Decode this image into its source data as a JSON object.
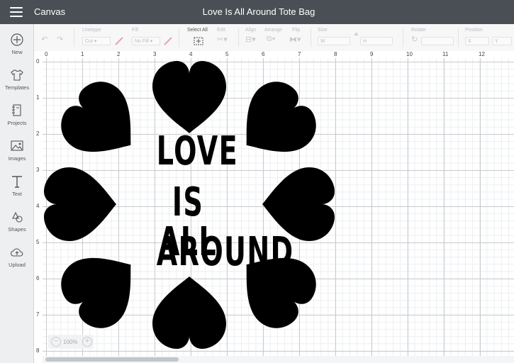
{
  "header": {
    "app_title": "Canvas",
    "doc_title": "Love Is All Around Tote Bag"
  },
  "sidebar": {
    "items": [
      {
        "label": "New",
        "icon": "plus-icon"
      },
      {
        "label": "Templates",
        "icon": "tshirt-icon"
      },
      {
        "label": "Projects",
        "icon": "notebook-icon"
      },
      {
        "label": "Images",
        "icon": "image-icon"
      },
      {
        "label": "Text",
        "icon": "text-icon"
      },
      {
        "label": "Shapes",
        "icon": "shapes-icon"
      },
      {
        "label": "Upload",
        "icon": "cloud-upload-icon"
      }
    ]
  },
  "toolbar": {
    "linetype_label": "Linetype",
    "linetype_value": "Cut",
    "fill_label": "Fill",
    "fill_value": "No Fill",
    "select_all_label": "Select All",
    "edit_label": "Edit",
    "align_label": "Align",
    "arrange_label": "Arrange",
    "flip_label": "Flip",
    "size_label": "Size",
    "size_w": "W",
    "size_h": "H",
    "rotate_label": "Rotate",
    "position_label": "Position",
    "pos_x": "X",
    "pos_y": "Y",
    "accent_color": "#e8a3b0"
  },
  "rulers": {
    "top": [
      "0",
      "1",
      "2",
      "3",
      "4",
      "5",
      "6",
      "7",
      "8",
      "9",
      "10",
      "11",
      "12"
    ],
    "left": [
      "0",
      "1",
      "2",
      "3",
      "4",
      "5",
      "6",
      "7",
      "8"
    ]
  },
  "design": {
    "lines": [
      "LOVE",
      "IS ALL",
      "AROUND"
    ],
    "color": "#000000"
  },
  "zoom": {
    "value": "100%",
    "minus": "−",
    "plus": "+"
  }
}
